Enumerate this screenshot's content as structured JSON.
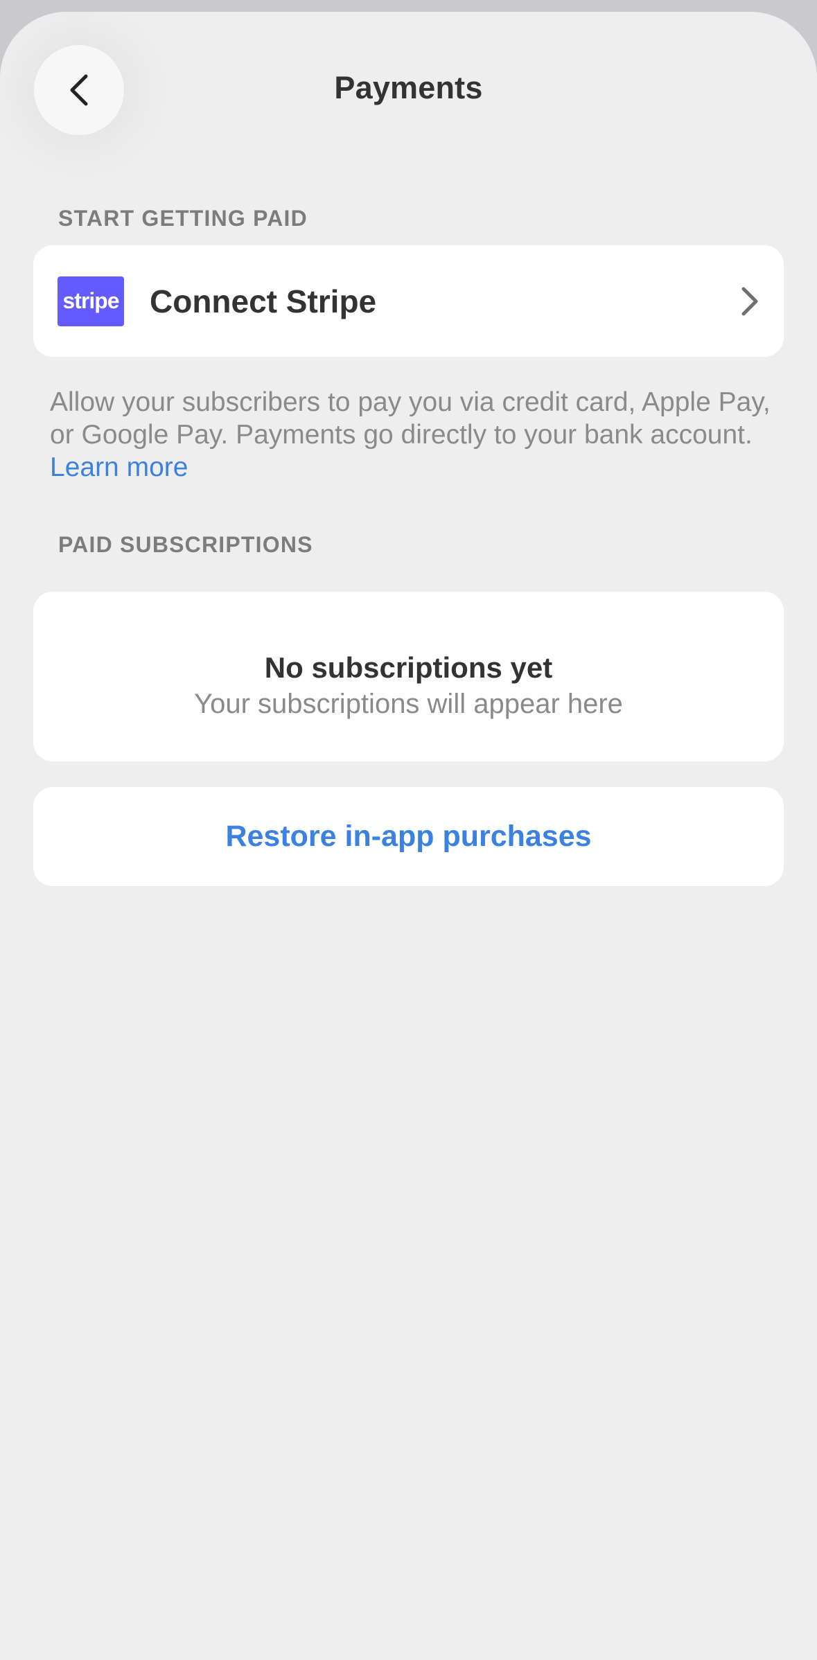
{
  "header": {
    "title": "Payments",
    "back_icon": "chevron-left-icon"
  },
  "sections": {
    "start_paid": {
      "header": "START GETTING PAID",
      "stripe": {
        "logo_text": "stripe",
        "label": "Connect Stripe",
        "chevron_icon": "chevron-right-icon",
        "brand_color": "#635bff"
      },
      "description": "Allow your subscribers to pay you via credit card, Apple Pay, or Google Pay. Payments go directly to your bank account.",
      "learn_more": "Learn more"
    },
    "paid_subscriptions": {
      "header": "PAID SUBSCRIPTIONS",
      "empty_title": "No subscriptions yet",
      "empty_subtitle": "Your subscriptions will appear here"
    }
  },
  "restore": {
    "label": "Restore in-app purchases"
  },
  "colors": {
    "accent": "#3b82e0",
    "background": "#eeeeee",
    "card": "#ffffff"
  }
}
